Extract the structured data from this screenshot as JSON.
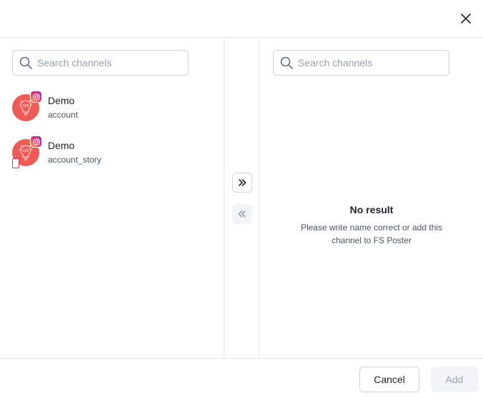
{
  "dialog": {
    "close_icon": "close-icon"
  },
  "left_panel": {
    "search_placeholder": "Search channels",
    "channels": [
      {
        "name": "Demo",
        "subtitle": "account",
        "network_icon": "instagram-icon",
        "avatar_color": "#ef5a55"
      },
      {
        "name": "Demo",
        "subtitle": "account_story",
        "network_icon": "instagram-icon",
        "type_icon": "story-icon",
        "avatar_color": "#ef5a55"
      }
    ]
  },
  "transfer": {
    "move_right_icon": "chevrons-right-icon",
    "move_left_icon": "chevrons-left-icon"
  },
  "right_panel": {
    "search_placeholder": "Search channels",
    "empty_title": "No result",
    "empty_description": "Please write name correct or add this channel to FS Poster"
  },
  "footer": {
    "cancel_label": "Cancel",
    "add_label": "Add"
  }
}
